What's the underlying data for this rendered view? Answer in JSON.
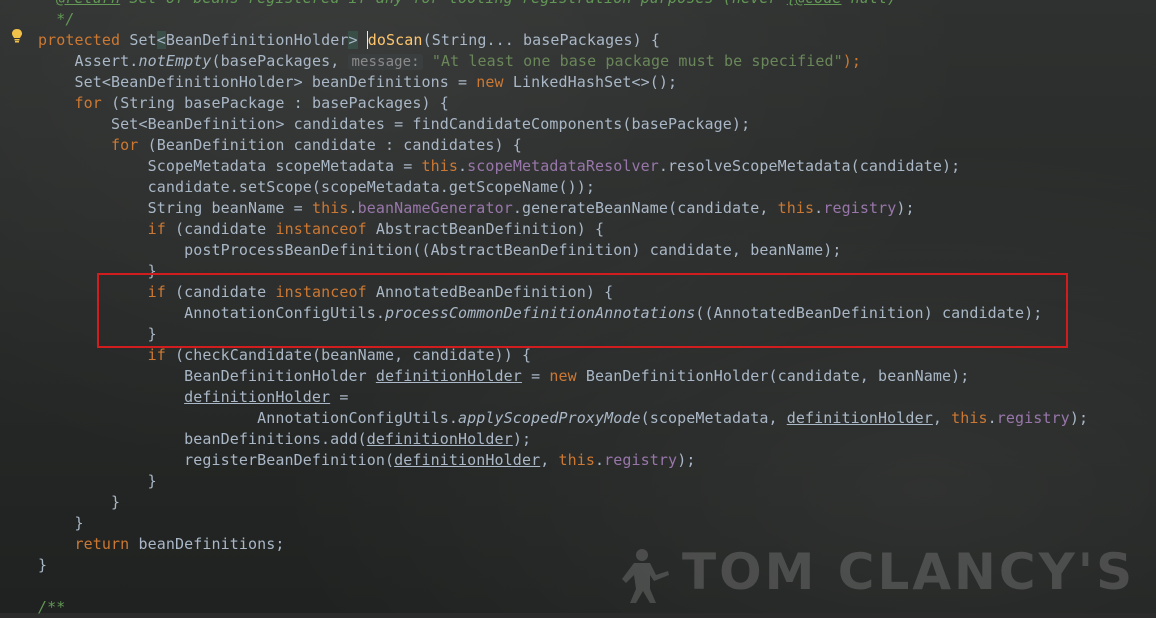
{
  "editor": {
    "lines": [
      {
        "segs": [
          {
            "t": "  "
          },
          {
            "t": "@return",
            "c": "cm ul"
          },
          {
            "t": " Set of beans registered if any for tooling registration purposes (never ",
            "c": "cm"
          },
          {
            "t": "{@code",
            "c": "cm ul"
          },
          {
            "t": " null)",
            "c": "cm"
          }
        ]
      },
      {
        "segs": [
          {
            "t": "  */",
            "c": "cm"
          }
        ]
      },
      {
        "segs": [
          {
            "t": "protected ",
            "c": "kw"
          },
          {
            "t": "Set"
          },
          {
            "t": "<",
            "c": "brace-hl"
          },
          {
            "t": "BeanDefinitionHolder"
          },
          {
            "t": ">",
            "c": "brace-hl"
          },
          {
            "t": " "
          },
          {
            "t": "",
            "c": "caret"
          },
          {
            "t": "doScan",
            "c": "fn"
          },
          {
            "t": "(String... basePackages) {"
          }
        ]
      },
      {
        "segs": [
          {
            "t": "    Assert."
          },
          {
            "t": "notEmpty",
            "c": "it"
          },
          {
            "t": "(basePackages, "
          },
          {
            "t": "message:",
            "c": "hint"
          },
          {
            "t": " "
          },
          {
            "t": "\"At least one base package must be specified\"",
            "c": "str"
          },
          {
            "t": ");",
            "c": "kw"
          }
        ]
      },
      {
        "segs": [
          {
            "t": "    Set<BeanDefinitionHolder> beanDefinitions = "
          },
          {
            "t": "new ",
            "c": "kw"
          },
          {
            "t": "LinkedHashSet<>();"
          }
        ]
      },
      {
        "segs": [
          {
            "t": "    "
          },
          {
            "t": "for ",
            "c": "kw"
          },
          {
            "t": "(String basePackage : basePackages) {"
          }
        ]
      },
      {
        "segs": [
          {
            "t": "        Set<BeanDefinition> candidates = findCandidateComponents(basePackage);"
          }
        ]
      },
      {
        "segs": [
          {
            "t": "        "
          },
          {
            "t": "for ",
            "c": "kw"
          },
          {
            "t": "(BeanDefinition candidate : candidates) {"
          }
        ]
      },
      {
        "segs": [
          {
            "t": "            ScopeMetadata scopeMetadata = "
          },
          {
            "t": "this",
            "c": "kw"
          },
          {
            "t": "."
          },
          {
            "t": "scopeMetadataResolver",
            "c": "fld"
          },
          {
            "t": ".resolveScopeMetadata(candidate);"
          }
        ]
      },
      {
        "segs": [
          {
            "t": "            candidate.setScope(scopeMetadata.getScopeName());"
          }
        ]
      },
      {
        "segs": [
          {
            "t": "            String beanName = "
          },
          {
            "t": "this",
            "c": "kw"
          },
          {
            "t": "."
          },
          {
            "t": "beanNameGenerator",
            "c": "fld"
          },
          {
            "t": ".generateBeanName(candidate, "
          },
          {
            "t": "this",
            "c": "kw"
          },
          {
            "t": "."
          },
          {
            "t": "registry",
            "c": "fld"
          },
          {
            "t": ");"
          }
        ]
      },
      {
        "segs": [
          {
            "t": "            "
          },
          {
            "t": "if ",
            "c": "kw"
          },
          {
            "t": "(candidate "
          },
          {
            "t": "instanceof ",
            "c": "kw"
          },
          {
            "t": "AbstractBeanDefinition) {"
          }
        ]
      },
      {
        "segs": [
          {
            "t": "                postProcessBeanDefinition((AbstractBeanDefinition) candidate, beanName);"
          }
        ]
      },
      {
        "segs": [
          {
            "t": "            }"
          }
        ]
      },
      {
        "segs": [
          {
            "t": "            "
          },
          {
            "t": "if ",
            "c": "kw"
          },
          {
            "t": "(candidate "
          },
          {
            "t": "instanceof ",
            "c": "kw"
          },
          {
            "t": "AnnotatedBeanDefinition) {"
          }
        ]
      },
      {
        "segs": [
          {
            "t": "                AnnotationConfigUtils."
          },
          {
            "t": "processCommonDefinitionAnnotations",
            "c": "it"
          },
          {
            "t": "((AnnotatedBeanDefinition) candidate);"
          }
        ]
      },
      {
        "segs": [
          {
            "t": "            }"
          }
        ]
      },
      {
        "segs": [
          {
            "t": "            "
          },
          {
            "t": "if ",
            "c": "kw"
          },
          {
            "t": "(checkCandidate(beanName, candidate)) {"
          }
        ]
      },
      {
        "segs": [
          {
            "t": "                BeanDefinitionHolder "
          },
          {
            "t": "definitionHolder",
            "c": "ul"
          },
          {
            "t": " = "
          },
          {
            "t": "new ",
            "c": "kw"
          },
          {
            "t": "BeanDefinitionHolder(candidate, beanName);"
          }
        ]
      },
      {
        "segs": [
          {
            "t": "                "
          },
          {
            "t": "definitionHolder",
            "c": "ul"
          },
          {
            "t": " ="
          }
        ]
      },
      {
        "segs": [
          {
            "t": "                        AnnotationConfigUtils."
          },
          {
            "t": "applyScopedProxyMode",
            "c": "it"
          },
          {
            "t": "(scopeMetadata, "
          },
          {
            "t": "definitionHolder",
            "c": "ul"
          },
          {
            "t": ", "
          },
          {
            "t": "this",
            "c": "kw"
          },
          {
            "t": "."
          },
          {
            "t": "registry",
            "c": "fld"
          },
          {
            "t": ");"
          }
        ]
      },
      {
        "segs": [
          {
            "t": "                beanDefinitions.add("
          },
          {
            "t": "definitionHolder",
            "c": "ul"
          },
          {
            "t": ");"
          }
        ]
      },
      {
        "segs": [
          {
            "t": "                registerBeanDefinition("
          },
          {
            "t": "definitionHolder",
            "c": "ul"
          },
          {
            "t": ", "
          },
          {
            "t": "this",
            "c": "kw"
          },
          {
            "t": "."
          },
          {
            "t": "registry",
            "c": "fld"
          },
          {
            "t": ");"
          }
        ]
      },
      {
        "segs": [
          {
            "t": "            }"
          }
        ]
      },
      {
        "segs": [
          {
            "t": "        }"
          }
        ]
      },
      {
        "segs": [
          {
            "t": "    }"
          }
        ]
      },
      {
        "segs": [
          {
            "t": "    "
          },
          {
            "t": "return ",
            "c": "kw"
          },
          {
            "t": "beanDefinitions;"
          }
        ]
      },
      {
        "segs": [
          {
            "t": "}"
          }
        ]
      },
      {
        "segs": [
          {
            "t": ""
          }
        ]
      },
      {
        "segs": [
          {
            "t": "/**",
            "c": "cm"
          }
        ]
      }
    ]
  },
  "watermark": {
    "text": "TOM CLANCY'S"
  },
  "colors": {
    "keyword": "#cc7832",
    "field": "#9876aa",
    "string": "#6a8759",
    "method": "#ffc66d",
    "comment": "#629755",
    "text": "#a9b7c6",
    "highlight_box": "#d11d1d"
  },
  "icons": {
    "intention_bulb": "lightbulb-icon",
    "watermark_figure": "soldier-silhouette-icon"
  }
}
